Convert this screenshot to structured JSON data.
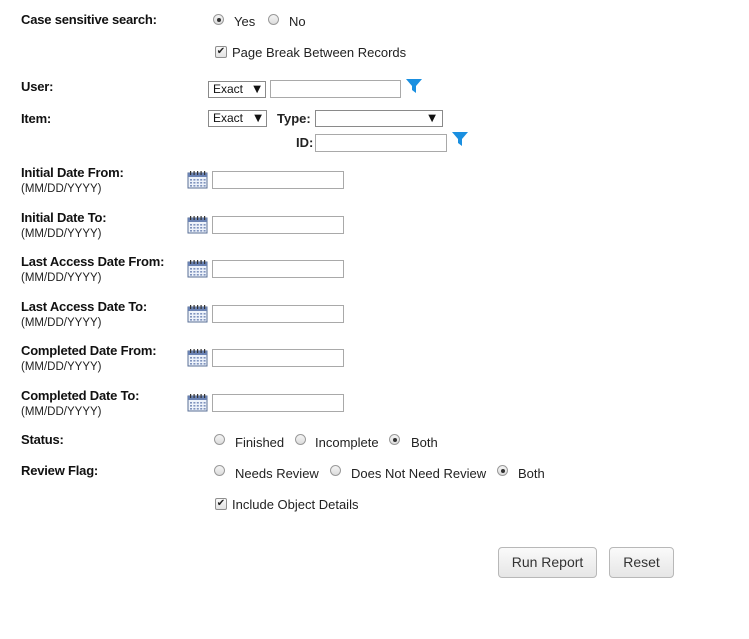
{
  "case_sensitive": {
    "label": "Case sensitive search:",
    "options": [
      {
        "label": "Yes",
        "selected": true
      },
      {
        "label": "No",
        "selected": false
      }
    ]
  },
  "page_break": {
    "label": "Page Break Between Records",
    "checked": true
  },
  "user": {
    "label": "User:",
    "match": "Exact",
    "value": ""
  },
  "item": {
    "label": "Item:",
    "match": "Exact",
    "type_label": "Type:",
    "type_value": "",
    "id_label": "ID:",
    "id_value": ""
  },
  "dates": [
    {
      "label": "Initial Date From:",
      "format": "(MM/DD/YYYY)",
      "value": ""
    },
    {
      "label": "Initial Date To:",
      "format": "(MM/DD/YYYY)",
      "value": ""
    },
    {
      "label": "Last Access Date From:",
      "format": "(MM/DD/YYYY)",
      "value": ""
    },
    {
      "label": "Last Access Date To:",
      "format": "(MM/DD/YYYY)",
      "value": ""
    },
    {
      "label": "Completed Date From:",
      "format": "(MM/DD/YYYY)",
      "value": ""
    },
    {
      "label": "Completed Date To:",
      "format": "(MM/DD/YYYY)",
      "value": ""
    }
  ],
  "status": {
    "label": "Status:",
    "options": [
      {
        "label": "Finished",
        "selected": false
      },
      {
        "label": "Incomplete",
        "selected": false
      },
      {
        "label": "Both",
        "selected": true
      }
    ]
  },
  "review_flag": {
    "label": "Review Flag:",
    "options": [
      {
        "label": "Needs Review",
        "selected": false
      },
      {
        "label": "Does Not Need Review",
        "selected": false
      },
      {
        "label": "Both",
        "selected": true
      }
    ]
  },
  "include_details": {
    "label": "Include Object Details",
    "checked": true
  },
  "buttons": {
    "run": "Run Report",
    "reset": "Reset"
  },
  "icons": {
    "filter": "filter-icon",
    "calendar": "calendar-icon"
  },
  "colors": {
    "filter": "#1a8fe0",
    "background": "#ffffff",
    "text": "#222222"
  }
}
